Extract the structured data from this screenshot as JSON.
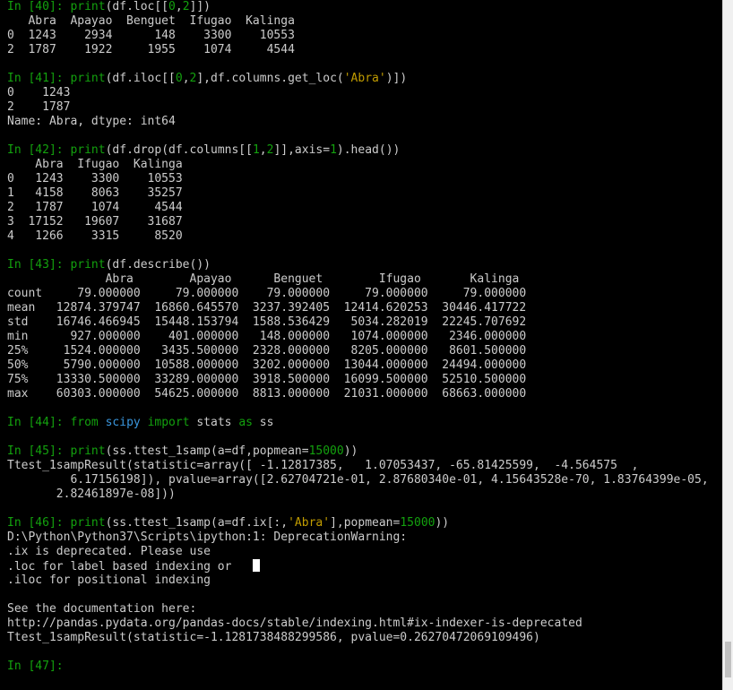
{
  "blocks": [
    {
      "prompt": "In [40]: ",
      "code": [
        {
          "t": "print",
          "c": "kw"
        },
        {
          "t": "(df.loc[[",
          "c": ""
        },
        {
          "t": "0",
          "c": "num"
        },
        {
          "t": ",",
          "c": ""
        },
        {
          "t": "2",
          "c": "num"
        },
        {
          "t": "]])",
          "c": ""
        }
      ],
      "output": [
        "   Abra  Apayao  Benguet  Ifugao  Kalinga",
        "0  1243    2934      148    3300    10553",
        "2  1787    1922     1955    1074     4544"
      ]
    },
    {
      "prompt": "In [41]: ",
      "code": [
        {
          "t": "print",
          "c": "kw"
        },
        {
          "t": "(df.iloc[[",
          "c": ""
        },
        {
          "t": "0",
          "c": "num"
        },
        {
          "t": ",",
          "c": ""
        },
        {
          "t": "2",
          "c": "num"
        },
        {
          "t": "],df.columns.get_loc(",
          "c": ""
        },
        {
          "t": "'Abra'",
          "c": "str"
        },
        {
          "t": ")])",
          "c": ""
        }
      ],
      "output": [
        "0    1243",
        "2    1787",
        "Name: Abra, dtype: int64"
      ]
    },
    {
      "prompt": "In [42]: ",
      "code": [
        {
          "t": "print",
          "c": "kw"
        },
        {
          "t": "(df.drop(df.columns[[",
          "c": ""
        },
        {
          "t": "1",
          "c": "num"
        },
        {
          "t": ",",
          "c": ""
        },
        {
          "t": "2",
          "c": "num"
        },
        {
          "t": "]],axis=",
          "c": ""
        },
        {
          "t": "1",
          "c": "num"
        },
        {
          "t": ").head())",
          "c": ""
        }
      ],
      "output": [
        "    Abra  Ifugao  Kalinga",
        "0   1243    3300    10553",
        "1   4158    8063    35257",
        "2   1787    1074     4544",
        "3  17152   19607    31687",
        "4   1266    3315     8520"
      ]
    },
    {
      "prompt": "In [43]: ",
      "code": [
        {
          "t": "print",
          "c": "kw"
        },
        {
          "t": "(df.describe())",
          "c": ""
        }
      ],
      "output": [
        "              Abra        Apayao      Benguet        Ifugao       Kalinga",
        "count     79.000000     79.000000    79.000000     79.000000     79.000000",
        "mean   12874.379747  16860.645570  3237.392405  12414.620253  30446.417722",
        "std    16746.466945  15448.153794  1588.536429   5034.282019  22245.707692",
        "min      927.000000    401.000000   148.000000   1074.000000   2346.000000",
        "25%     1524.000000   3435.500000  2328.000000   8205.000000   8601.500000",
        "50%     5790.000000  10588.000000  3202.000000  13044.000000  24494.000000",
        "75%    13330.500000  33289.000000  3918.500000  16099.500000  52510.500000",
        "max    60303.000000  54625.000000  8813.000000  21031.000000  68663.000000"
      ]
    },
    {
      "prompt": "In [44]: ",
      "code": [
        {
          "t": "from",
          "c": "kw"
        },
        {
          "t": " ",
          "c": ""
        },
        {
          "t": "scipy",
          "c": "ind"
        },
        {
          "t": " ",
          "c": ""
        },
        {
          "t": "import",
          "c": "kw"
        },
        {
          "t": " stats ",
          "c": ""
        },
        {
          "t": "as",
          "c": "kw"
        },
        {
          "t": " ss",
          "c": ""
        }
      ],
      "output": []
    },
    {
      "prompt": "In [45]: ",
      "code": [
        {
          "t": "print",
          "c": "kw"
        },
        {
          "t": "(ss.ttest_1samp(a=df,popmean=",
          "c": ""
        },
        {
          "t": "15000",
          "c": "num"
        },
        {
          "t": "))",
          "c": ""
        }
      ],
      "output": [
        "Ttest_1sampResult(statistic=array([ -1.12817385,   1.07053437, -65.81425599,  -4.564575  ,",
        "         6.17156198]), pvalue=array([2.62704721e-01, 2.87680340e-01, 4.15643528e-70, 1.83764399e-05,",
        "       2.82461897e-08]))"
      ]
    },
    {
      "prompt": "In [46]: ",
      "code": [
        {
          "t": "print",
          "c": "kw"
        },
        {
          "t": "(ss.ttest_1samp(a=df.ix[:,",
          "c": ""
        },
        {
          "t": "'Abra'",
          "c": "str"
        },
        {
          "t": "],popmean=",
          "c": ""
        },
        {
          "t": "15000",
          "c": "num"
        },
        {
          "t": "))",
          "c": ""
        }
      ],
      "output": [
        "D:\\Python\\Python37\\Scripts\\ipython:1: DeprecationWarning:",
        ".ix is deprecated. Please use",
        ".loc for label based indexing or   ",
        ".iloc for positional indexing",
        "",
        "See the documentation here:",
        "http://pandas.pydata.org/pandas-docs/stable/indexing.html#ix-indexer-is-deprecated",
        "Ttest_1sampResult(statistic=-1.1281738488299586, pvalue=0.26270472069109496)"
      ],
      "cursor_after_line": 2
    },
    {
      "prompt": "In [47]: ",
      "code": [],
      "output": []
    }
  ],
  "colors": {
    "background": "#000000",
    "foreground": "#cccccc",
    "prompt": "#13a10e",
    "keyword": "#13a10e",
    "string": "#c19c00",
    "number": "#13a10e",
    "identifier": "#3a96dd"
  }
}
